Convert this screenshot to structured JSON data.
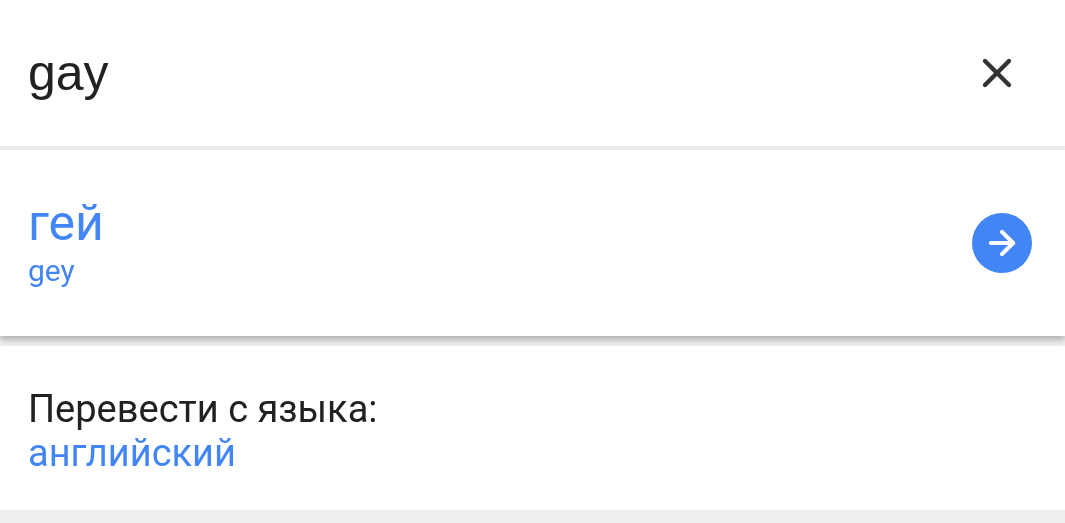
{
  "search": {
    "value": "gay"
  },
  "translation": {
    "text": "гей",
    "transliteration": "gey"
  },
  "source_language": {
    "label": "Перевести с языка:",
    "value": "английский"
  }
}
